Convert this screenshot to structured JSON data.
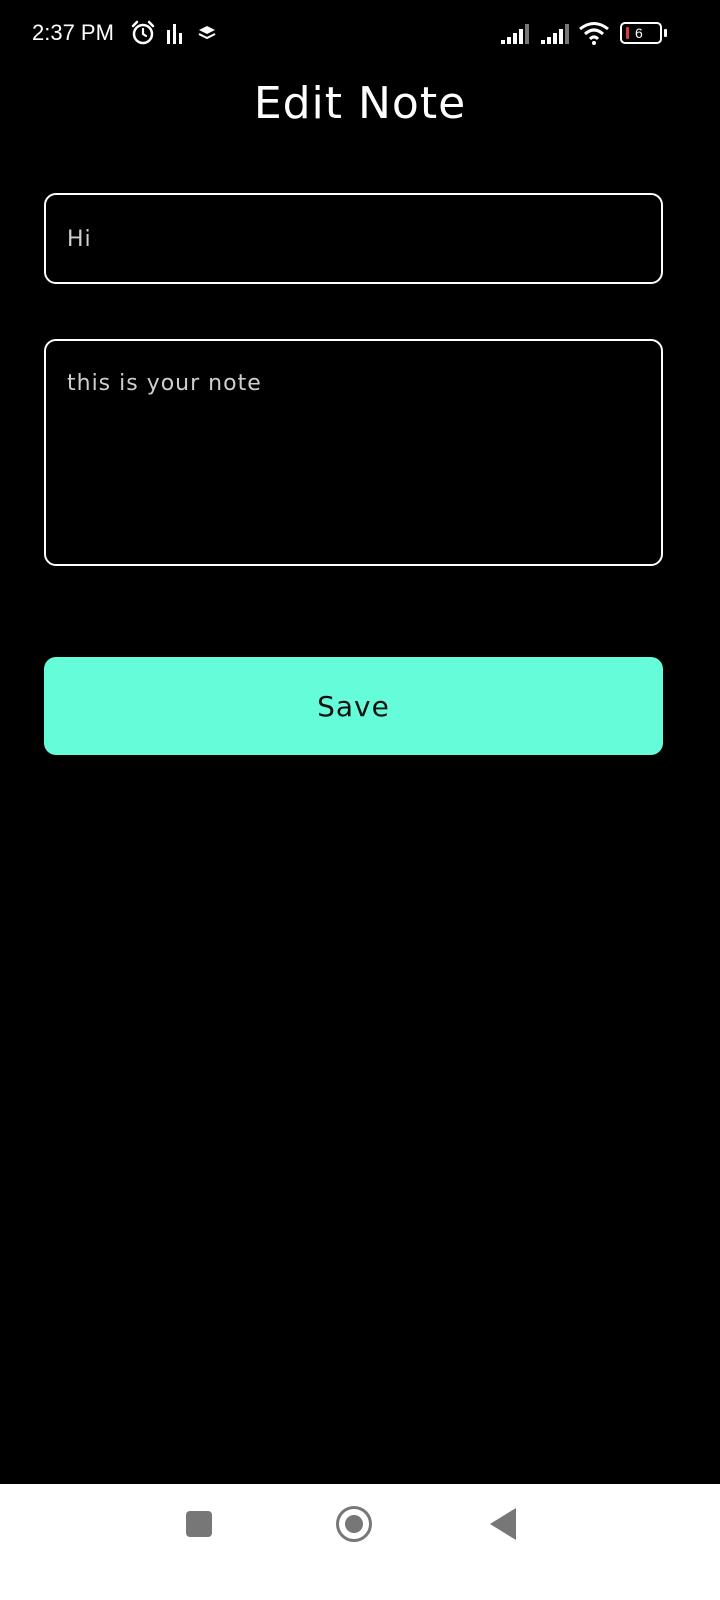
{
  "status_bar": {
    "time": "2:37 PM",
    "icons": [
      "alarm-icon",
      "equalizer-icon",
      "layers-icon",
      "signal-icon",
      "signal-icon",
      "wifi-icon",
      "battery-icon"
    ],
    "battery_level": "6",
    "battery_low_color": "#e53935"
  },
  "page": {
    "title": "Edit Note"
  },
  "form": {
    "title_value": "Hi",
    "note_value": "this is your note"
  },
  "save_button": {
    "label": "Save",
    "color": "#64FCD9"
  },
  "nav_bar": {
    "icons": [
      "recents-icon",
      "home-icon",
      "back-icon"
    ]
  }
}
